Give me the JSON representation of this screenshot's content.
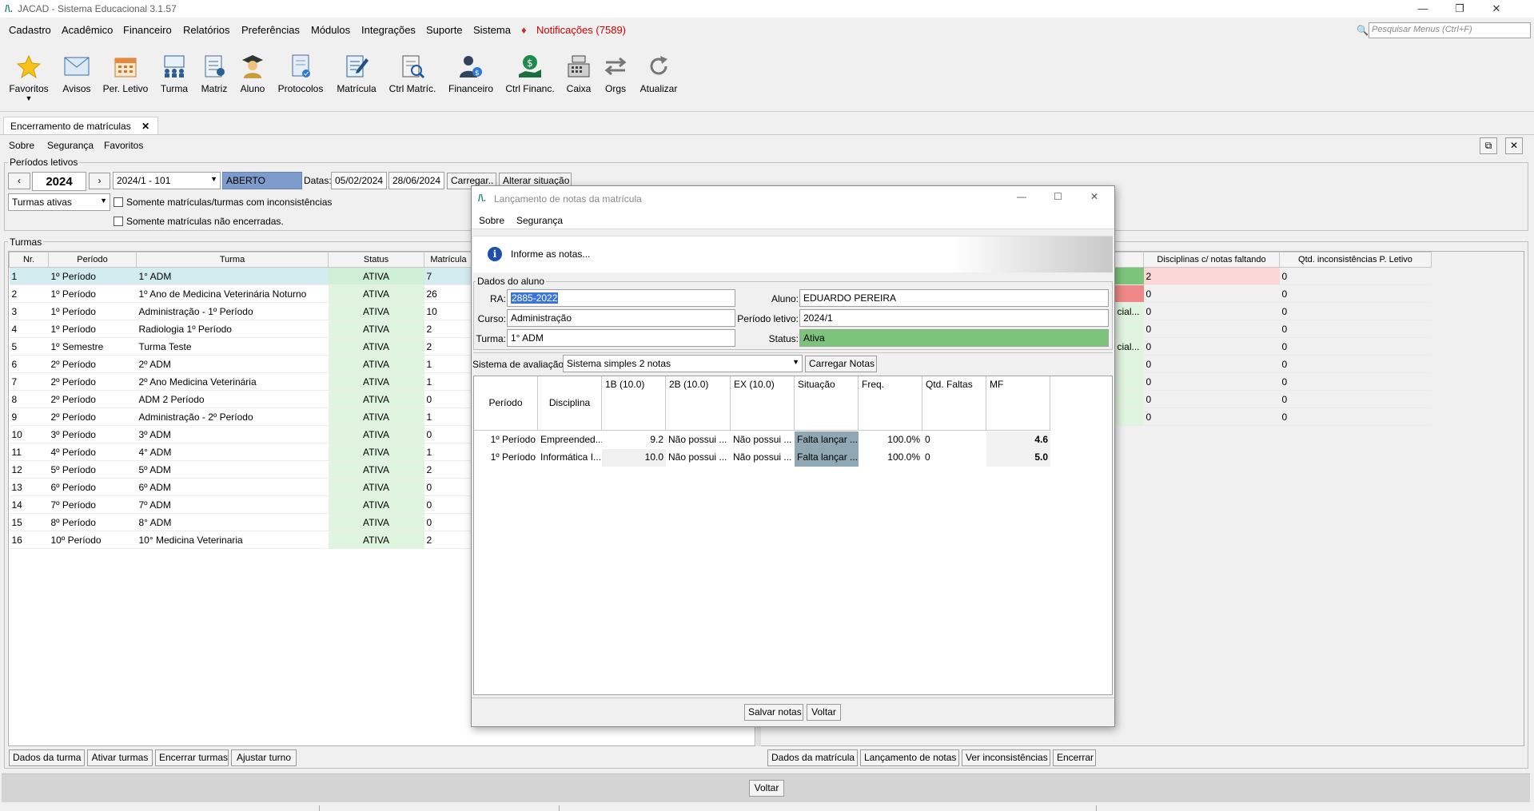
{
  "app": {
    "title": "JACAD - Sistema Educacional 3.1.57"
  },
  "menubar": {
    "items": [
      {
        "label": "Cadastro"
      },
      {
        "label": "Acadêmico"
      },
      {
        "label": "Financeiro"
      },
      {
        "label": "Relatórios"
      },
      {
        "label": "Preferências"
      },
      {
        "label": "Módulos"
      },
      {
        "label": "Integrações"
      },
      {
        "label": "Suporte"
      },
      {
        "label": "Sistema"
      }
    ],
    "notifications": "Notificações (7589)",
    "search_placeholder": "Pesquisar Menus (Ctrl+F)"
  },
  "toolbar": {
    "items": [
      {
        "label": "Favoritos",
        "icon": "star-icon"
      },
      {
        "label": "Avisos",
        "icon": "envelope-icon"
      },
      {
        "label": "Per. Letivo",
        "icon": "calendar-icon"
      },
      {
        "label": "Turma",
        "icon": "class-group-icon"
      },
      {
        "label": "Matriz",
        "icon": "matrix-document-icon"
      },
      {
        "label": "Aluno",
        "icon": "student-icon"
      },
      {
        "label": "Protocolos",
        "icon": "protocol-icon"
      },
      {
        "label": "Matrícula",
        "icon": "enrollment-edit-icon"
      },
      {
        "label": "Ctrl Matríc.",
        "icon": "enrollment-search-icon"
      },
      {
        "label": "Financeiro",
        "icon": "finance-person-icon"
      },
      {
        "label": "Ctrl Financ.",
        "icon": "money-hand-icon"
      },
      {
        "label": "Caixa",
        "icon": "cash-register-icon"
      },
      {
        "label": "Orgs",
        "icon": "arrows-exchange-icon"
      },
      {
        "label": "Atualizar",
        "icon": "refresh-icon"
      }
    ]
  },
  "doc_tab": {
    "label": "Encerramento de matrículas",
    "close": "✕"
  },
  "submenu": {
    "sobre": "Sobre",
    "seguranca": "Segurança",
    "favoritos": "Favoritos"
  },
  "periodos": {
    "title": "Períodos letivos",
    "prev": "‹",
    "next": "›",
    "year": "2024",
    "period_select": "2024/1 - 101",
    "situation": "ABERTO",
    "dates_label": "Datas:",
    "date_start": "05/02/2024",
    "date_end": "28/06/2024",
    "load_button": "Carregar..",
    "change_status_button": "Alterar situação",
    "filter_select": "Turmas ativas",
    "cb_inconsistencias": "Somente matrículas/turmas com inconsistências",
    "cb_nao_encerradas": "Somente matrículas não encerradas."
  },
  "turmas": {
    "title": "Turmas",
    "columns": [
      "Nr.",
      "Período",
      "Turma",
      "Status",
      "Matrícula"
    ],
    "rows": [
      {
        "nr": "1",
        "periodo": "1º Período",
        "turma": "1° ADM",
        "status": "ATIVA",
        "mat": "7"
      },
      {
        "nr": "2",
        "periodo": "1º Período",
        "turma": "1º Ano de Medicina Veterinária Noturno",
        "status": "ATIVA",
        "mat": "26"
      },
      {
        "nr": "3",
        "periodo": "1º Período",
        "turma": "Administração - 1º Período",
        "status": "ATIVA",
        "mat": "10"
      },
      {
        "nr": "4",
        "periodo": "1º Período",
        "turma": "Radiologia 1º Período",
        "status": "ATIVA",
        "mat": "2"
      },
      {
        "nr": "5",
        "periodo": "1º Semestre",
        "turma": "Turma Teste",
        "status": "ATIVA",
        "mat": "2"
      },
      {
        "nr": "6",
        "periodo": "2º Período",
        "turma": "2º ADM",
        "status": "ATIVA",
        "mat": "1"
      },
      {
        "nr": "7",
        "periodo": "2º Período",
        "turma": "2º Ano Medicina Veterinária",
        "status": "ATIVA",
        "mat": "1"
      },
      {
        "nr": "8",
        "periodo": "2º Período",
        "turma": "ADM 2 Período",
        "status": "ATIVA",
        "mat": "0"
      },
      {
        "nr": "9",
        "periodo": "2º Período",
        "turma": "Administração - 2º Período",
        "status": "ATIVA",
        "mat": "1"
      },
      {
        "nr": "10",
        "periodo": "3º Período",
        "turma": "3º ADM",
        "status": "ATIVA",
        "mat": "0"
      },
      {
        "nr": "11",
        "periodo": "4º Período",
        "turma": "4° ADM",
        "status": "ATIVA",
        "mat": "1"
      },
      {
        "nr": "12",
        "periodo": "5º Período",
        "turma": "5º ADM",
        "status": "ATIVA",
        "mat": "2"
      },
      {
        "nr": "13",
        "periodo": "6º Período",
        "turma": "6º ADM",
        "status": "ATIVA",
        "mat": "0"
      },
      {
        "nr": "14",
        "periodo": "7º Período",
        "turma": "7º ADM",
        "status": "ATIVA",
        "mat": "0"
      },
      {
        "nr": "15",
        "periodo": "8º Período",
        "turma": "8° ADM",
        "status": "ATIVA",
        "mat": "0"
      },
      {
        "nr": "16",
        "periodo": "10º Período",
        "turma": "10°  Medicina Veterinaria",
        "status": "ATIVA",
        "mat": "2"
      }
    ],
    "buttons": [
      "Dados da turma",
      "Ativar turmas",
      "Encerrar turmas",
      "Ajustar turno"
    ]
  },
  "right_table": {
    "columns": [
      "Disciplinas c/ notas faltando",
      "Qtd. inconsistências P. Letivo"
    ],
    "partial_col": [
      "",
      "",
      "cial...",
      "",
      "cial...",
      "",
      "",
      "",
      ""
    ],
    "rows": [
      {
        "faltando": "2",
        "inconsist": "0"
      },
      {
        "faltando": "0",
        "inconsist": "0"
      },
      {
        "faltando": "0",
        "inconsist": "0"
      },
      {
        "faltando": "0",
        "inconsist": "0"
      },
      {
        "faltando": "0",
        "inconsist": "0"
      },
      {
        "faltando": "0",
        "inconsist": "0"
      },
      {
        "faltando": "0",
        "inconsist": "0"
      },
      {
        "faltando": "0",
        "inconsist": "0"
      },
      {
        "faltando": "0",
        "inconsist": "0"
      }
    ],
    "buttons": [
      "Dados da matrícula",
      "Lançamento de notas",
      "Ver inconsistências",
      "Encerrar"
    ]
  },
  "main_voltar": "Voltar",
  "dialog": {
    "title": "Lançamento de notas da matrícula",
    "menu": {
      "sobre": "Sobre",
      "seguranca": "Segurança"
    },
    "info": "Informe as notas...",
    "dados_title": "Dados do aluno",
    "ra_label": "RA:",
    "ra": "2885-2022",
    "aluno_label": "Aluno:",
    "aluno": "EDUARDO PEREIRA",
    "curso_label": "Curso:",
    "curso": "Administração",
    "periodo_label": "Período letivo:",
    "periodo": "2024/1",
    "turma_label": "Turma:",
    "turma": "1° ADM",
    "status_label": "Status:",
    "status": "Ativa",
    "sistema_label": "Sistema de avaliação:",
    "sistema": "Sistema simples 2 notas",
    "carregar": "Carregar Notas",
    "grade_columns": [
      "Período",
      "Disciplina",
      "1B (10.0)",
      "2B (10.0)",
      "EX (10.0)",
      "Situação",
      "Freq.",
      "Qtd. Faltas",
      "MF"
    ],
    "grades": [
      {
        "periodo": "1º Período",
        "disciplina": "Empreended...",
        "b1": "9.2",
        "b2": "Não possui ...",
        "ex": "Não possui ...",
        "situacao": "Falta lançar ...",
        "freq": "100.0%",
        "faltas": "0",
        "mf": "4.6"
      },
      {
        "periodo": "1º Período",
        "disciplina": "Informática I...",
        "b1": "10.0",
        "b2": "Não possui ...",
        "ex": "Não possui ...",
        "situacao": "Falta lançar ...",
        "freq": "100.0%",
        "faltas": "0",
        "mf": "5.0"
      }
    ],
    "salvar": "Salvar notas",
    "voltar": "Voltar"
  },
  "colors": {
    "ativa_bg": "#dff5df",
    "situacao_bg": "#8fa8b4",
    "status_green": "#7cc47c",
    "red_flag": "#f08888",
    "pink_flag": "#fbd6d6",
    "green_flag": "#7cc47c"
  }
}
